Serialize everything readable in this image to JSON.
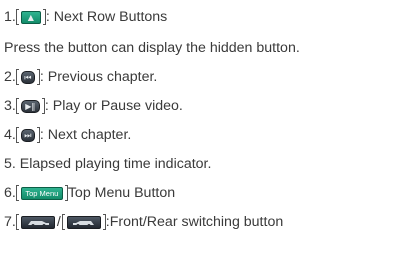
{
  "items": [
    {
      "num": "1.",
      "text": ": Next Row Buttons",
      "icon": "up-arrow-icon"
    },
    {
      "num": "",
      "text": "Press the button can display the hidden button."
    },
    {
      "num": "2.",
      "text": ": Previous chapter.",
      "icon": "previous-chapter-icon"
    },
    {
      "num": "3.",
      "text": ": Play or Pause video.",
      "icon": "play-pause-icon"
    },
    {
      "num": "4.",
      "text": ": Next chapter.",
      "icon": "next-chapter-icon"
    },
    {
      "num": "5.",
      "text": " Elapsed playing time indicator."
    },
    {
      "num": "6.",
      "text": "Top Menu Button",
      "icon_text": "Top Menu",
      "icon": "top-menu-icon"
    },
    {
      "num": "7.",
      "sep": "/",
      "text": ":Front/Rear switching button",
      "icon": "front-rear-icon"
    }
  ],
  "colors": {
    "text": "#3a3a3a",
    "green_button": "#1a9c78",
    "dark_button": "#2c323a"
  }
}
